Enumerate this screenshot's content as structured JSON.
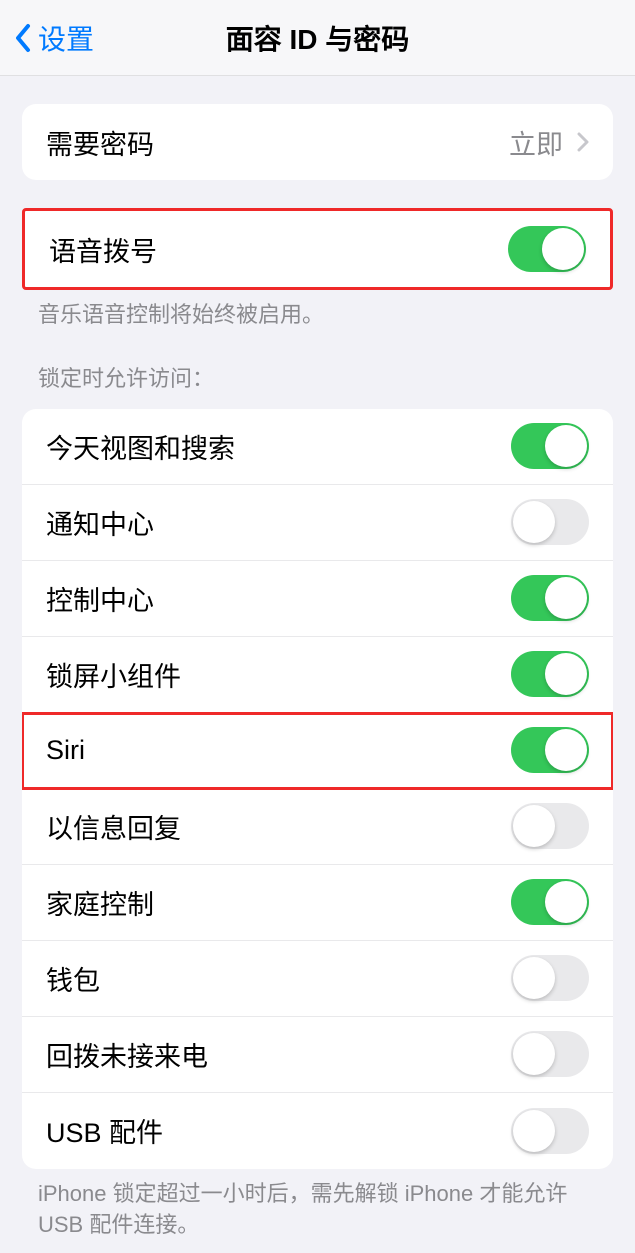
{
  "header": {
    "back_label": "设置",
    "title": "面容 ID 与密码"
  },
  "require_passcode": {
    "label": "需要密码",
    "value": "立即"
  },
  "voice_dial": {
    "label": "语音拨号",
    "on": true,
    "footer": "音乐语音控制将始终被启用。"
  },
  "lock_access": {
    "header": "锁定时允许访问：",
    "items": [
      {
        "label": "今天视图和搜索",
        "on": true
      },
      {
        "label": "通知中心",
        "on": false
      },
      {
        "label": "控制中心",
        "on": true
      },
      {
        "label": "锁屏小组件",
        "on": true
      },
      {
        "label": "Siri",
        "on": true
      },
      {
        "label": "以信息回复",
        "on": false
      },
      {
        "label": "家庭控制",
        "on": true
      },
      {
        "label": "钱包",
        "on": false
      },
      {
        "label": "回拨未接来电",
        "on": false
      },
      {
        "label": "USB 配件",
        "on": false
      }
    ],
    "footer": "iPhone 锁定超过一小时后，需先解锁 iPhone 才能允许 USB 配件连接。"
  }
}
